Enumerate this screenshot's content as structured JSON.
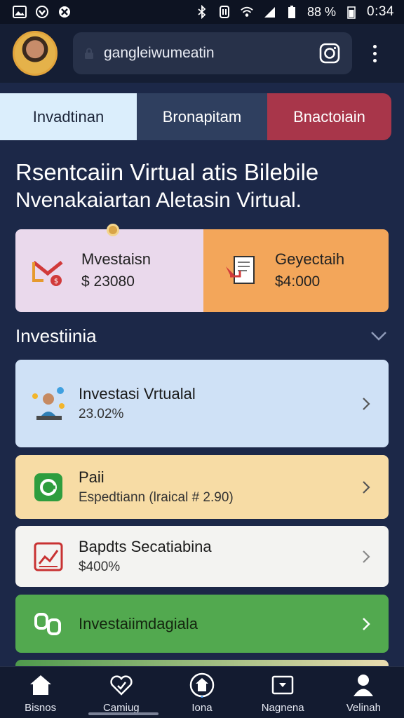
{
  "status_bar": {
    "icons_left": [
      "gallery-icon",
      "vpn-icon",
      "app-icon"
    ],
    "icons_right": [
      "bluetooth-icon",
      "nfc-icon",
      "wifi-icon",
      "signal-icon",
      "battery-icon"
    ],
    "battery": "88 %",
    "time": "0:34"
  },
  "app_bar": {
    "url": "gangleiwumeatin",
    "icons": [
      "avatar",
      "lock-icon",
      "camera-icon",
      "more-vert-icon"
    ]
  },
  "tabs": [
    {
      "label": "Invadtinan",
      "color": "#dbeefc"
    },
    {
      "label": "Bronapitam",
      "color": "#2f3f5f"
    },
    {
      "label": "Bnactoiain",
      "color": "#a8364a"
    }
  ],
  "headline": {
    "line1": "Rsentcaiin Virtual atis Bilebile",
    "line2": "Nvenakaiartan Aletasin Virtual."
  },
  "summary": {
    "left": {
      "label": "Mvestaisn",
      "value": "$ 23080",
      "icon": "mail-chart-icon",
      "color": "#ead9ec"
    },
    "right": {
      "label": "Geyectaih",
      "value": "$4:000",
      "icon": "document-icon",
      "color": "#f3a65a"
    }
  },
  "section": {
    "title": "Investiinia"
  },
  "list": [
    {
      "title": "Investasi Vrtualal",
      "subtitle": "23.02%",
      "icon": "investor-icon",
      "color": "#cfe1f6"
    },
    {
      "title": "Paii",
      "subtitle": "Espedtiann (lraical # 2.90)",
      "icon": "green-app-icon",
      "color": "#f7dca5"
    },
    {
      "title": "Bapdts Secatiabina",
      "subtitle": "$400%",
      "icon": "chart-icon",
      "color": "#f3f3f1"
    },
    {
      "title": "Investaiimdagiala",
      "subtitle": "",
      "icon": "link-icon",
      "color": "#52a94f"
    }
  ],
  "bottom_nav": [
    {
      "label": "Bisnos",
      "icon": "home-icon"
    },
    {
      "label": "Camiug",
      "icon": "heart-icon"
    },
    {
      "label": "Iona",
      "icon": "house-circle-icon"
    },
    {
      "label": "Nagnena",
      "icon": "inbox-icon"
    },
    {
      "label": "Velinah",
      "icon": "person-icon"
    }
  ]
}
